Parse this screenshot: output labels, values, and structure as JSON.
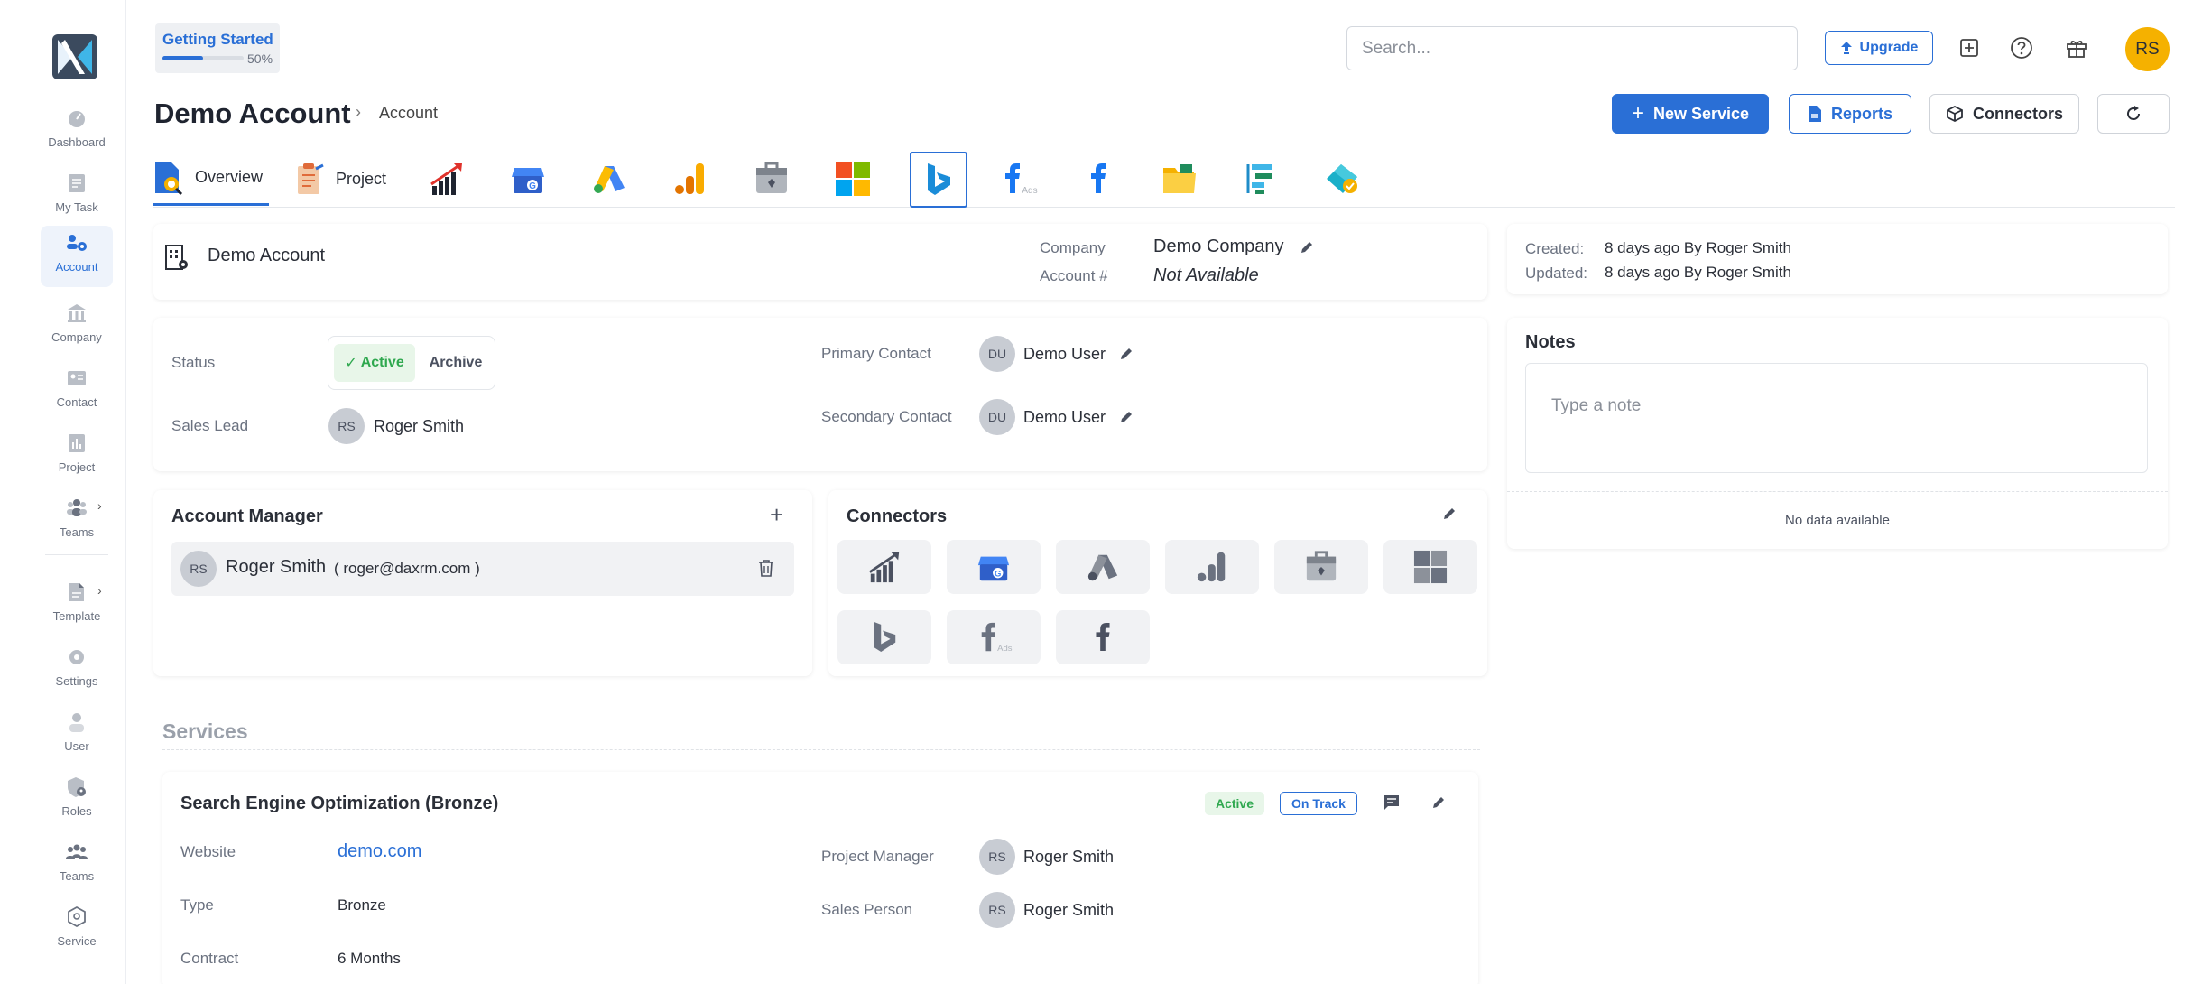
{
  "sidebar": {
    "items": [
      {
        "label": "Dashboard",
        "icon": "dashboard-icon"
      },
      {
        "label": "My Task",
        "icon": "task-icon"
      },
      {
        "label": "Account",
        "icon": "account-icon"
      },
      {
        "label": "Company",
        "icon": "company-icon"
      },
      {
        "label": "Contact",
        "icon": "contact-icon"
      },
      {
        "label": "Project",
        "icon": "project-icon"
      },
      {
        "label": "Teams",
        "icon": "teams-icon"
      },
      {
        "label": "Template",
        "icon": "template-icon"
      },
      {
        "label": "Settings",
        "icon": "settings-icon"
      },
      {
        "label": "User",
        "icon": "user-icon"
      },
      {
        "label": "Roles",
        "icon": "roles-icon"
      },
      {
        "label": "Teams",
        "icon": "teams-icon"
      },
      {
        "label": "Service",
        "icon": "service-icon"
      }
    ],
    "active_item": "Account"
  },
  "getting_started": {
    "label": "Getting Started",
    "progress": 0.5,
    "percent_label": "50%"
  },
  "header": {
    "search_placeholder": "Search...",
    "upgrade_label": "Upgrade",
    "avatar_initials": "RS"
  },
  "page": {
    "title": "Demo Account",
    "breadcrumb": "Account",
    "new_service_label": "New Service",
    "reports_label": "Reports",
    "connectors_label": "Connectors"
  },
  "tabs": [
    {
      "label": "Overview",
      "icon": "overview-icon",
      "active": true
    },
    {
      "label": "Project",
      "icon": "project-clipboard-icon"
    },
    {
      "label": "",
      "icon": "growth-chart-icon"
    },
    {
      "label": "",
      "icon": "google-business-icon"
    },
    {
      "label": "",
      "icon": "google-ads-icon"
    },
    {
      "label": "",
      "icon": "google-analytics-icon"
    },
    {
      "label": "",
      "icon": "search-console-icon"
    },
    {
      "label": "",
      "icon": "microsoft-icon"
    },
    {
      "label": "",
      "icon": "bing-icon"
    },
    {
      "label": "",
      "icon": "facebook-ads-icon"
    },
    {
      "label": "",
      "icon": "facebook-icon"
    },
    {
      "label": "",
      "icon": "folder-icon"
    },
    {
      "label": "",
      "icon": "tasks-list-icon"
    },
    {
      "label": "",
      "icon": "data-studio-icon"
    }
  ],
  "account_card": {
    "name": "Demo Account",
    "company_label": "Company",
    "company_value": "Demo Company",
    "account_no_label": "Account #",
    "account_no_value": "Not Available"
  },
  "meta": {
    "created_label": "Created:",
    "created_value": "8 days ago By Roger Smith",
    "updated_label": "Updated:",
    "updated_value": "8 days ago By Roger Smith"
  },
  "details": {
    "status_label": "Status",
    "status_active": "Active",
    "status_archive": "Archive",
    "sales_lead_label": "Sales Lead",
    "sales_lead_initials": "RS",
    "sales_lead_name": "Roger Smith",
    "primary_contact_label": "Primary Contact",
    "primary_contact_initials": "DU",
    "primary_contact_name": "Demo User",
    "secondary_contact_label": "Secondary Contact",
    "secondary_contact_initials": "DU",
    "secondary_contact_name": "Demo User"
  },
  "notes": {
    "title": "Notes",
    "placeholder": "Type a note",
    "empty_text": "No data available"
  },
  "account_manager": {
    "title": "Account Manager",
    "initials": "RS",
    "name": "Roger Smith",
    "email": "( roger@daxrm.com )"
  },
  "connectors_card": {
    "title": "Connectors",
    "items": [
      "growth-chart-icon",
      "google-business-icon",
      "google-ads-icon",
      "google-analytics-icon",
      "search-console-icon",
      "microsoft-icon",
      "bing-icon",
      "facebook-ads-icon",
      "facebook-icon"
    ]
  },
  "services": {
    "section_title": "Services",
    "service": {
      "name": "Search Engine Optimization (Bronze)",
      "status_badge": "Active",
      "track_badge": "On Track",
      "website_label": "Website",
      "website_value": "demo.com",
      "type_label": "Type",
      "type_value": "Bronze",
      "contract_label": "Contract",
      "contract_value": "6 Months",
      "pm_label": "Project Manager",
      "pm_initials": "RS",
      "pm_name": "Roger Smith",
      "sp_label": "Sales Person",
      "sp_initials": "RS",
      "sp_name": "Roger Smith"
    }
  },
  "colors": {
    "accent": "#2a6fd6",
    "success": "#2fa84f",
    "avatar": "#f5b100"
  }
}
